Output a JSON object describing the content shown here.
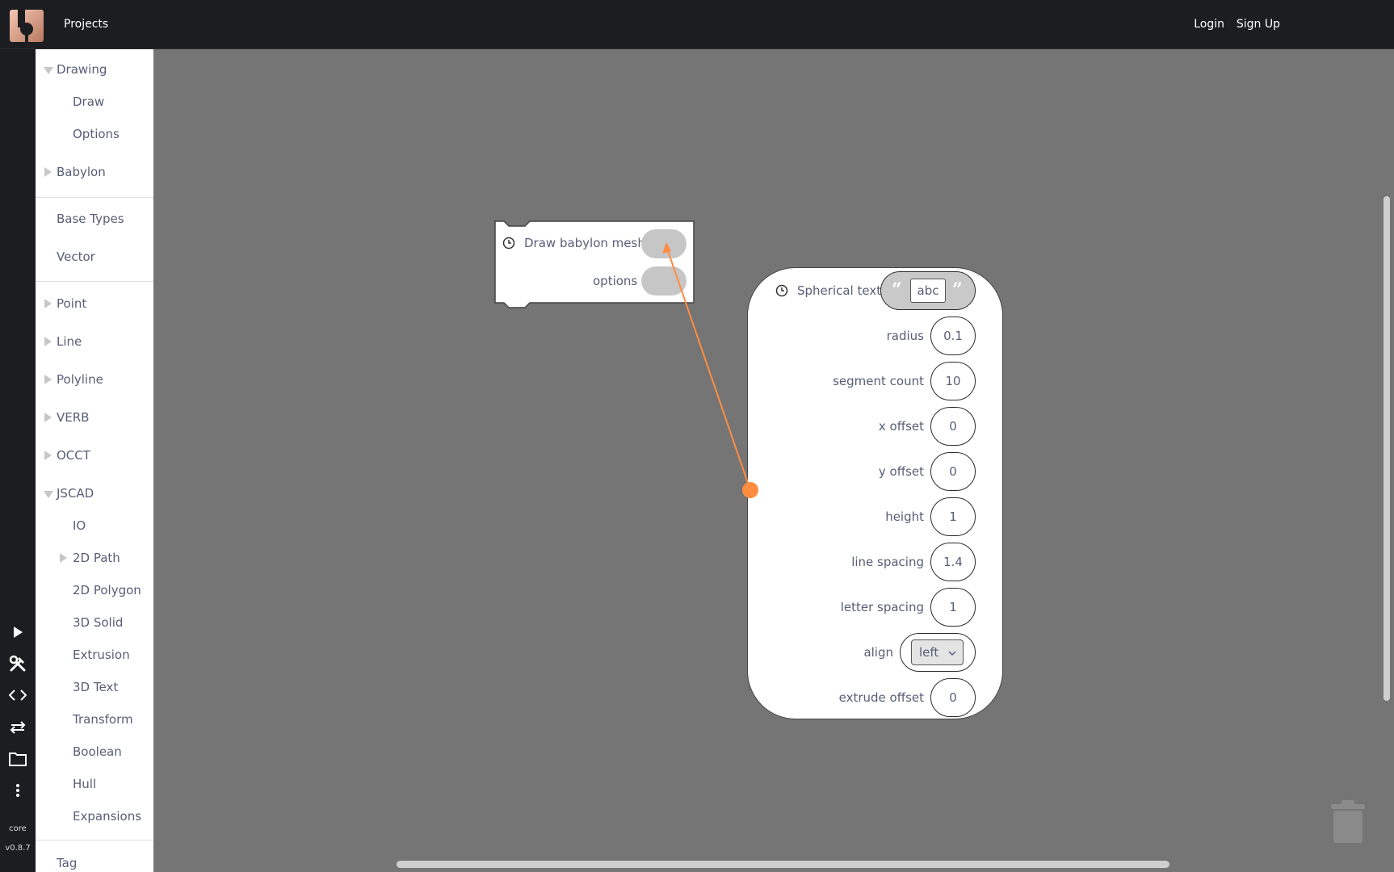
{
  "topbar": {
    "projects": "Projects",
    "login": "Login",
    "signup": "Sign Up"
  },
  "rail": {
    "core": "core",
    "version": "v0.8.7"
  },
  "sidebar": {
    "drawing": "Drawing",
    "draw": "Draw",
    "options": "Options",
    "babylon": "Babylon",
    "base_types": "Base Types",
    "vector": "Vector",
    "point": "Point",
    "line": "Line",
    "polyline": "Polyline",
    "verb": "VERB",
    "occt": "OCCT",
    "jscad": "JSCAD",
    "io": "IO",
    "path2d": "2D Path",
    "polygon2d": "2D Polygon",
    "solid3d": "3D Solid",
    "extrusion": "Extrusion",
    "text3d": "3D Text",
    "transform": "Transform",
    "boolean": "Boolean",
    "hull": "Hull",
    "expansions": "Expansions",
    "tag": "Tag"
  },
  "draw_block": {
    "title": "Draw babylon mesh",
    "options_label": "options"
  },
  "text_block": {
    "title": "Spherical text",
    "text_value": "abc",
    "open_quote": "“",
    "close_quote": "”",
    "radius_label": "radius",
    "radius": "0.1",
    "segment_label": "segment count",
    "segment": "10",
    "xoffset_label": "x offset",
    "xoffset": "0",
    "yoffset_label": "y offset",
    "yoffset": "0",
    "height_label": "height",
    "height": "1",
    "linespacing_label": "line spacing",
    "linespacing": "1.4",
    "letterspacing_label": "letter spacing",
    "letterspacing": "1",
    "align_label": "align",
    "align": "left",
    "extrude_label": "extrude offset",
    "extrude": "0"
  },
  "colors": {
    "connection": "#ff8c40",
    "workspace": "#757575",
    "topbar": "#1c1d21"
  }
}
